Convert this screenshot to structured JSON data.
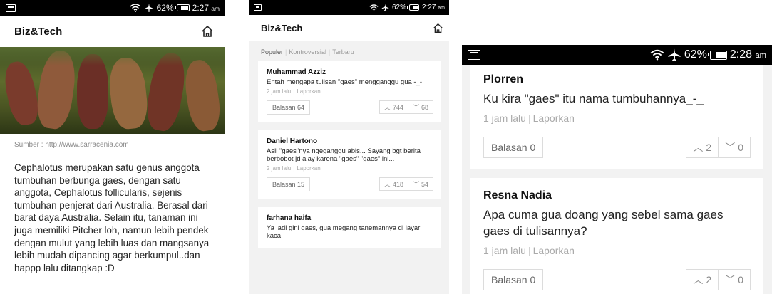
{
  "status": {
    "left": {
      "battery": "62%",
      "time": "2:27",
      "ampm": "am"
    },
    "middle": {
      "battery": "62%",
      "time": "2:27",
      "ampm": "am"
    },
    "right": {
      "battery": "62%",
      "time": "2:28",
      "ampm": "am"
    }
  },
  "app": {
    "title": "Biz&Tech"
  },
  "article": {
    "caption": "Sumber : http://www.sarracenia.com",
    "body": "Cephalotus merupakan satu genus anggota tumbuhan berbunga gaes, dengan satu anggota, Cephalotus follicularis, sejenis tumbuhan penjerat dari Australia. Berasal dari barat daya Australia. Selain itu, tanaman ini juga memiliki Pitcher loh, namun lebih pendek dengan mulut yang lebih luas dan mangsanya lebih mudah dipancing agar berkumpul..dan happp lalu ditangkap :D"
  },
  "tabs": [
    "Populer",
    "Kontroversial",
    "Terbaru"
  ],
  "comments_middle": [
    {
      "author": "Muhammad Azziz",
      "body": "Entah mengapa tulisan \"gaes\" mengganggu gua -_-",
      "time": "2 jam lalu",
      "report": "Laporkan",
      "replies": "Balasan 64",
      "up": "744",
      "down": "68"
    },
    {
      "author": "Daniel Hartono",
      "body": "Asli \"gaes\"nya ngeganggu abis... Sayang bgt berita berbobot jd alay karena \"gaes\" \"gaes\" ini...",
      "time": "2 jam lalu",
      "report": "Laporkan",
      "replies": "Balasan 15",
      "up": "418",
      "down": "54"
    },
    {
      "author": "farhana haifa",
      "body": "Ya jadi gini gaes, gua megang tanemannya di layar kaca"
    }
  ],
  "comments_right": [
    {
      "author": "Plorren",
      "body": "Ku kira \"gaes\" itu nama tumbuhannya_-_",
      "time": "1 jam lalu",
      "report": "Laporkan",
      "replies": "Balasan 0",
      "up": "2",
      "down": "0"
    },
    {
      "author": "Resna Nadia",
      "body": "Apa cuma gua doang yang sebel sama gaes gaes di tulisannya?",
      "time": "1 jam lalu",
      "report": "Laporkan",
      "replies": "Balasan 0",
      "up": "2",
      "down": "0"
    }
  ]
}
